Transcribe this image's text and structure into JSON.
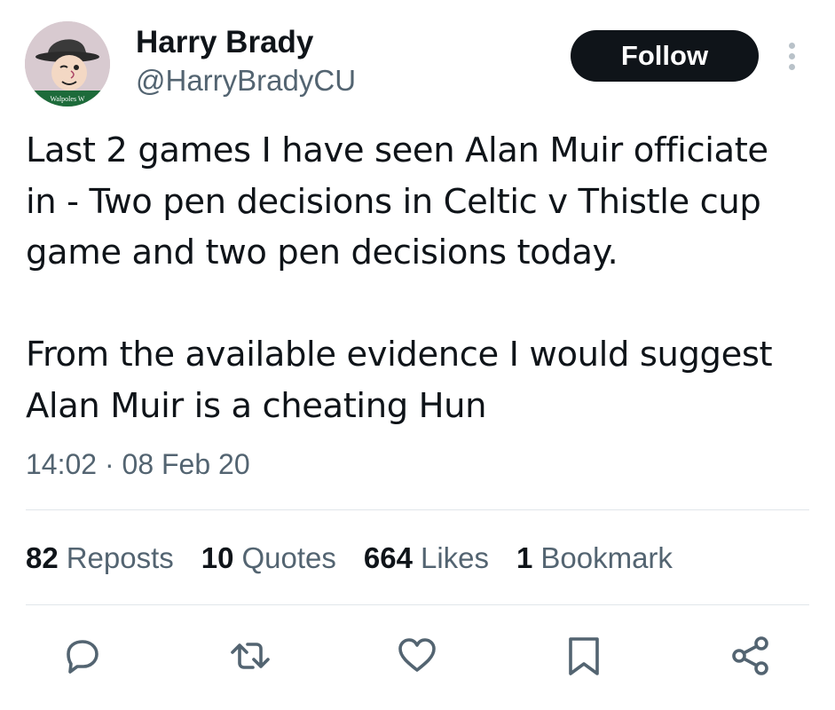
{
  "user": {
    "display_name": "Harry Brady",
    "handle": "@HarryBradyCU",
    "avatar_text": "Walpoles W"
  },
  "follow_button": {
    "label": "Follow"
  },
  "more_button": {
    "icon": "more-vertical-icon"
  },
  "tweet": {
    "paragraphs": [
      "Last 2 games I have seen Alan Muir officiate\nin - Two pen decisions in Celtic v Thistle cup\ngame and two pen decisions today.",
      "From the available evidence I would suggest\nAlan Muir is a cheating Hun"
    ],
    "timestamp": "14:02 · 08 Feb 20"
  },
  "stats": [
    {
      "count": "82",
      "label": "Reposts"
    },
    {
      "count": "10",
      "label": "Quotes"
    },
    {
      "count": "664",
      "label": "Likes"
    },
    {
      "count": "1",
      "label": "Bookmark"
    }
  ],
  "actions": [
    {
      "name": "reply",
      "icon": "reply-icon"
    },
    {
      "name": "repost",
      "icon": "repost-icon"
    },
    {
      "name": "like",
      "icon": "heart-icon"
    },
    {
      "name": "bookmark",
      "icon": "bookmark-icon"
    },
    {
      "name": "share",
      "icon": "share-icon"
    }
  ],
  "colors": {
    "text_primary": "#0f1419",
    "text_secondary": "#536471",
    "divider": "#e1e6ea",
    "follow_bg": "#0f1419",
    "follow_text": "#ffffff"
  }
}
